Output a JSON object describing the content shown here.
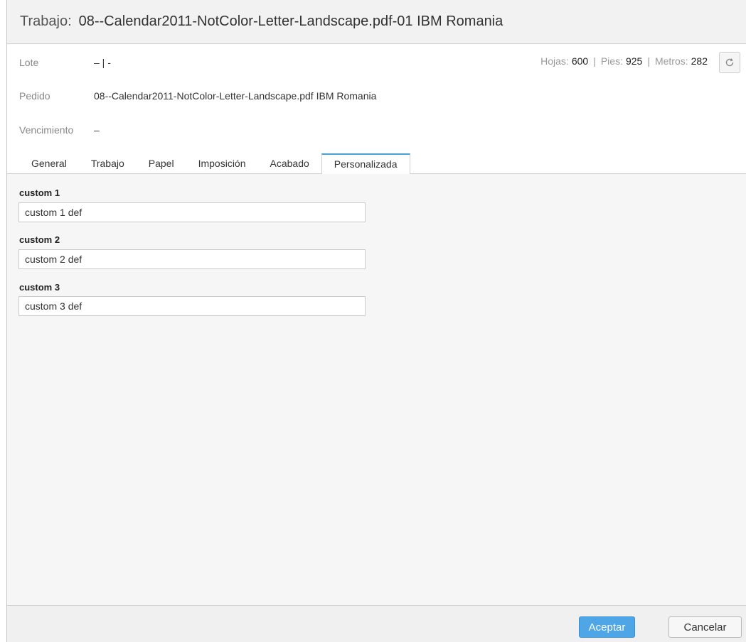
{
  "header": {
    "title_label": "Trabajo:",
    "title_value": "08--Calendar2011-NotColor-Letter-Landscape.pdf-01 IBM Romania"
  },
  "meta": {
    "lote_label": "Lote",
    "lote_value": "– | -",
    "pedido_label": "Pedido",
    "pedido_value": "08--Calendar2011-NotColor-Letter-Landscape.pdf IBM Romania",
    "vencimiento_label": "Vencimiento",
    "vencimiento_value": "–"
  },
  "counts": {
    "hojas_label": "Hojas:",
    "hojas_value": "600",
    "pies_label": "Pies:",
    "pies_value": "925",
    "metros_label": "Metros:",
    "metros_value": "282",
    "separator": "|"
  },
  "tabs": [
    {
      "label": "General"
    },
    {
      "label": "Trabajo"
    },
    {
      "label": "Papel"
    },
    {
      "label": "Imposición"
    },
    {
      "label": "Acabado"
    },
    {
      "label": "Personalizada",
      "active": true
    }
  ],
  "custom_fields": [
    {
      "label": "custom 1",
      "value": "custom 1 def"
    },
    {
      "label": "custom 2",
      "value": "custom 2 def"
    },
    {
      "label": "custom 3",
      "value": "custom 3 def"
    }
  ],
  "footer": {
    "accept_label": "Aceptar",
    "cancel_label": "Cancelar"
  },
  "icons": {
    "refresh": "refresh-icon"
  },
  "colors": {
    "accent": "#4ea6e6",
    "active_tab_border": "#4a9fd8"
  }
}
